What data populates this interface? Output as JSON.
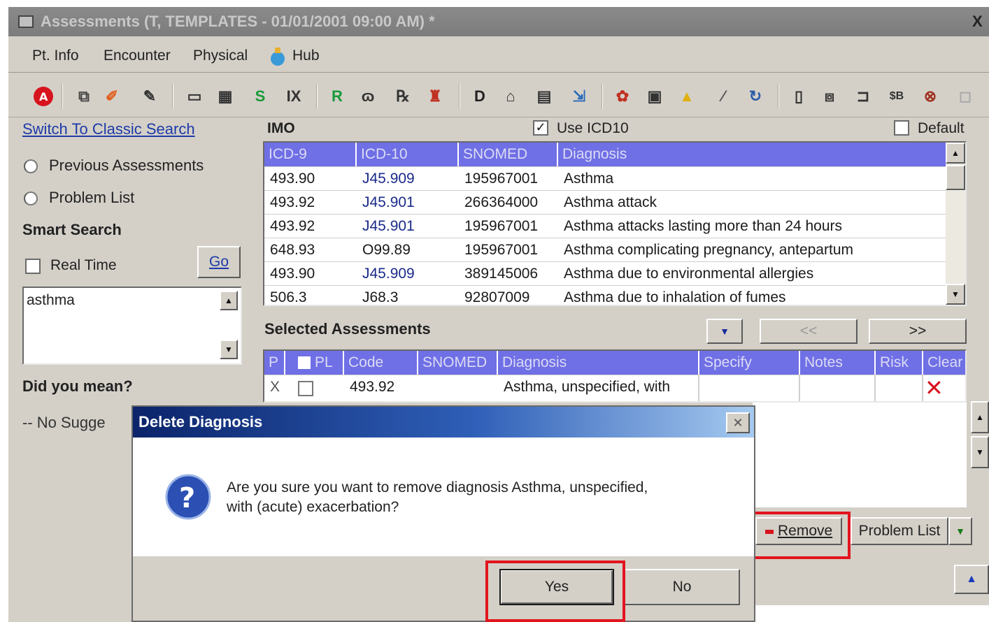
{
  "window": {
    "title": "Assessments (T, TEMPLATES - 01/01/2001 09:00 AM) *",
    "close": "X"
  },
  "menu": {
    "items": [
      "Pt. Info",
      "Encounter",
      "Physical",
      "Hub"
    ]
  },
  "toolbar": {
    "icons": [
      "stop-icon",
      "copy-icon",
      "brush-icon",
      "pen-icon",
      "note-icon",
      "chart-icon",
      "s-icon",
      "ix-icon",
      "r-icon",
      "glasses-icon",
      "rx-icon",
      "bottle-icon",
      "dx-icon",
      "house-icon",
      "calendar-icon",
      "import-icon",
      "bag-icon",
      "book-icon",
      "bell-icon",
      "pills-icon",
      "refresh-icon",
      "doc-icon",
      "docs-icon",
      "flow-icon",
      "sb-icon",
      "bag2-icon",
      "disabled-icon"
    ]
  },
  "left": {
    "switch_link": "Switch To Classic Search",
    "previous_assessments": "Previous Assessments",
    "problem_list": "Problem List",
    "smart_search": "Smart Search",
    "real_time": "Real Time",
    "go": "Go",
    "search_text": "asthma",
    "did_you_mean": "Did you mean?",
    "no_suggestions": "-- No Sugge"
  },
  "imo": {
    "label": "IMO",
    "use_icd10": "Use ICD10",
    "default": "Default",
    "columns": [
      "ICD-9",
      "ICD-10",
      "SNOMED",
      "Diagnosis"
    ],
    "rows": [
      {
        "icd9": "493.90",
        "icd10": "J45.909",
        "snomed": "195967001",
        "diagnosis": "Asthma"
      },
      {
        "icd9": "493.92",
        "icd10": "J45.901",
        "snomed": "266364000",
        "diagnosis": "Asthma attack"
      },
      {
        "icd9": "493.92",
        "icd10": "J45.901",
        "snomed": "195967001",
        "diagnosis": "Asthma attacks lasting more than 24 hours"
      },
      {
        "icd9": "648.93",
        "icd10": "O99.89",
        "snomed": "195967001",
        "diagnosis": "Asthma complicating pregnancy, antepartum"
      },
      {
        "icd9": "493.90",
        "icd10": "J45.909",
        "snomed": "389145006",
        "diagnosis": "Asthma due to environmental allergies"
      },
      {
        "icd9": "506.3",
        "icd10": "J68.3",
        "snomed": "92807009",
        "diagnosis": "Asthma due to inhalation of fumes"
      }
    ]
  },
  "selected": {
    "label": "Selected Assessments",
    "prev": "<<",
    "next": ">>",
    "columns": [
      "P",
      "PL",
      "Code",
      "SNOMED",
      "Diagnosis",
      "Specify",
      "Notes",
      "Risk",
      "Clear"
    ],
    "row": {
      "p": "X",
      "code": "493.92",
      "snomed": "",
      "diagnosis": "Asthma, unspecified, with"
    },
    "remove": "Remove",
    "problem_list": "Problem List"
  },
  "dialog": {
    "title": "Delete Diagnosis",
    "message_line1": "Are you sure you want to remove diagnosis Asthma, unspecified,",
    "message_line2": "with (acute) exacerbation?",
    "yes": "Yes",
    "no": "No"
  },
  "colors": {
    "grid_header": "#6f6fe6",
    "highlight": "#e2141e",
    "dialog_title": "#0b246a"
  }
}
